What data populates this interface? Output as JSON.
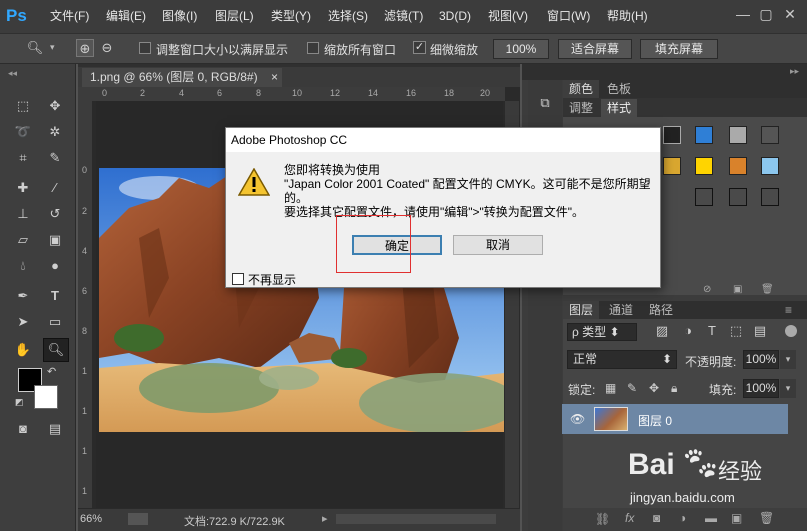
{
  "menubar": {
    "logo": "Ps",
    "items": [
      "文件(F)",
      "编辑(E)",
      "图像(I)",
      "图层(L)",
      "类型(Y)",
      "选择(S)",
      "滤镜(T)",
      "3D(D)",
      "视图(V)",
      "窗口(W)",
      "帮助(H)"
    ]
  },
  "options": {
    "resize_windows": "调整窗口大小以满屏显示",
    "zoom_all": "缩放所有窗口",
    "scrubby": "细微缩放",
    "zoom_100": "100%",
    "fit_screen": "适合屏幕",
    "fill_screen": "填充屏幕"
  },
  "document": {
    "tab_title": "1.png @ 66% (图层 0, RGB/8#)",
    "tab_close": "×",
    "ruler_h": [
      "0",
      "2",
      "4",
      "6",
      "8",
      "10",
      "12",
      "14",
      "16",
      "18",
      "20"
    ],
    "ruler_v": [
      "0",
      "2",
      "4",
      "6",
      "8",
      "1",
      "1",
      "1",
      "1"
    ],
    "zoom": "66%",
    "doc_info": "文档:722.9 K/722.9K"
  },
  "panels": {
    "color_tab": "颜色",
    "swatches_tab": "色板",
    "adjust_tab": "调整",
    "styles_tab": "样式",
    "layers_tab": "图层",
    "channels_tab": "通道",
    "paths_tab": "路径",
    "filter_kind": "类型",
    "blend_mode": "正常",
    "opacity_label": "不透明度:",
    "opacity_value": "100%",
    "lock_label": "锁定:",
    "fill_label": "填充:",
    "fill_value": "100%",
    "layer_name": "图层 0"
  },
  "dialog": {
    "title": "Adobe Photoshop CC",
    "line1": "您即将转换为使用",
    "line2": "\"Japan Color 2001 Coated\" 配置文件的 CMYK。这可能不是您所期望",
    "line3": "的。",
    "line4": "要选择其它配置文件，请使用\"编辑\">\"转换为配置文件\"。",
    "ok": "确定",
    "cancel": "取消",
    "dont_show": "不再显示"
  },
  "watermark": {
    "brand": "Bai",
    "brand2": "经验",
    "url": "jingyan.baidu.com"
  },
  "colors": {
    "accent_ps": "#31a8ff",
    "layer_selected": "#6d87a5",
    "highlight_box": "#e03030"
  }
}
